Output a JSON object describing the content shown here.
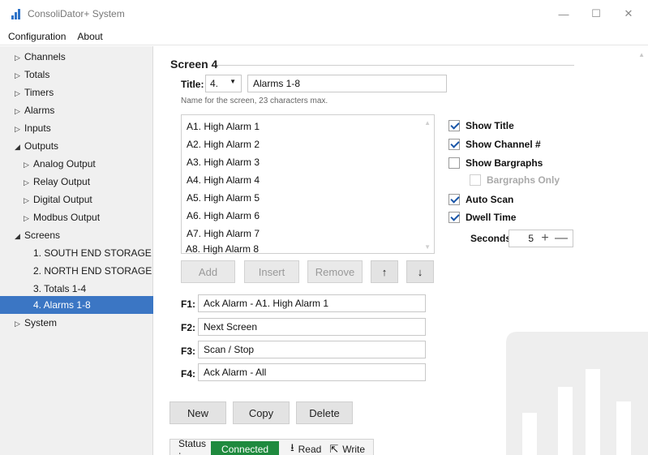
{
  "window": {
    "title": "ConsoliDator+ System",
    "minimize_glyph": "—",
    "maximize_glyph": "☐",
    "close_glyph": "✕"
  },
  "menu": [
    "Configuration",
    "About"
  ],
  "sidebar": {
    "items": [
      {
        "label": "Channels",
        "arrow": "▷"
      },
      {
        "label": "Totals",
        "arrow": "▷"
      },
      {
        "label": "Timers",
        "arrow": "▷"
      },
      {
        "label": "Alarms",
        "arrow": "▷"
      },
      {
        "label": "Inputs",
        "arrow": "▷"
      },
      {
        "label": "Outputs",
        "arrow": "◢"
      },
      {
        "label": "Analog Output",
        "arrow": "▷"
      },
      {
        "label": "Relay Output",
        "arrow": "▷"
      },
      {
        "label": "Digital Output",
        "arrow": "▷"
      },
      {
        "label": "Modbus Output",
        "arrow": "▷"
      },
      {
        "label": "Screens",
        "arrow": "◢"
      },
      {
        "label": "1. SOUTH END STORAGE",
        "arrow": ""
      },
      {
        "label": "2. NORTH END STORAGE",
        "arrow": ""
      },
      {
        "label": "3. Totals 1-4",
        "arrow": ""
      },
      {
        "label": "4. Alarms 1-8",
        "arrow": ""
      },
      {
        "label": "System",
        "arrow": "▷"
      }
    ],
    "selected_index": 14
  },
  "screen": {
    "heading": "Screen 4",
    "title_label": "Title:",
    "title_number": "4.",
    "title_value": "Alarms 1-8",
    "title_hint": "Name for the screen, 23 characters max.",
    "channels": [
      "A1. High Alarm 1",
      "A2. High Alarm 2",
      "A3. High Alarm 3",
      "A4. High Alarm 4",
      "A5. High Alarm 5",
      "A6. High Alarm 6",
      "A7. High Alarm 7",
      "A8. High Alarm 8"
    ],
    "list_buttons": {
      "add": "Add",
      "insert": "Insert",
      "remove": "Remove",
      "up": "↑",
      "down": "↓"
    },
    "options": {
      "show_title": {
        "label": "Show Title",
        "checked": true
      },
      "show_channel": {
        "label": "Show Channel #",
        "checked": true
      },
      "show_bargraphs": {
        "label": "Show Bargraphs",
        "checked": false
      },
      "bargraphs_only": {
        "label": "Bargraphs Only",
        "checked": false
      },
      "auto_scan": {
        "label": "Auto Scan",
        "checked": true
      },
      "dwell_time": {
        "label": "Dwell Time",
        "checked": true
      }
    },
    "seconds_label": "Seconds:",
    "seconds_value": "5",
    "function_keys": [
      {
        "key": "F1:",
        "value": "Ack Alarm - A1. High Alarm 1"
      },
      {
        "key": "F2:",
        "value": "Next Screen"
      },
      {
        "key": "F3:",
        "value": "Scan / Stop"
      },
      {
        "key": "F4:",
        "value": "Ack Alarm - All"
      }
    ],
    "actions": {
      "new": "New",
      "copy": "Copy",
      "delete": "Delete"
    }
  },
  "status": {
    "label": "Status :",
    "state": "Connected",
    "read": "Read",
    "write": "Write"
  },
  "colors": {
    "accent": "#3b76c4",
    "connected": "#1f8a3e",
    "check": "#1a56a8"
  }
}
